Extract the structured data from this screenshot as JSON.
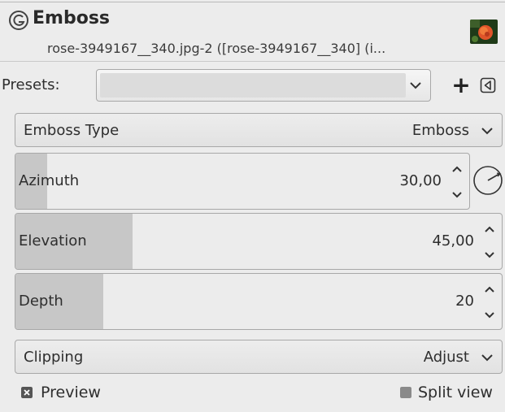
{
  "header": {
    "title": "Emboss",
    "subtitle": "rose-3949167__340.jpg-2 ([rose-3949167__340] (i..."
  },
  "presets": {
    "label": "Presets:",
    "value": "",
    "add_label": "+"
  },
  "emboss_type": {
    "label": "Emboss Type",
    "value": "Emboss"
  },
  "azimuth": {
    "label": "Azimuth",
    "value": "30,00",
    "fill_fraction": 0.07
  },
  "elevation": {
    "label": "Elevation",
    "value": "45,00",
    "fill_fraction": 0.24
  },
  "depth": {
    "label": "Depth",
    "value": "20",
    "fill_fraction": 0.18
  },
  "clipping": {
    "label": "Clipping",
    "value": "Adjust"
  },
  "preview": {
    "label": "Preview",
    "checked": true
  },
  "split_view": {
    "label": "Split view",
    "checked": false
  },
  "icons": {
    "filter": "gimp-filter-icon",
    "thumbnail": "image-thumbnail",
    "add": "plus-icon",
    "menu": "dialog-menu-icon",
    "chevron": "chevron-down-icon",
    "spin": "spin-arrows-icon",
    "dial": "angle-dial-icon"
  }
}
